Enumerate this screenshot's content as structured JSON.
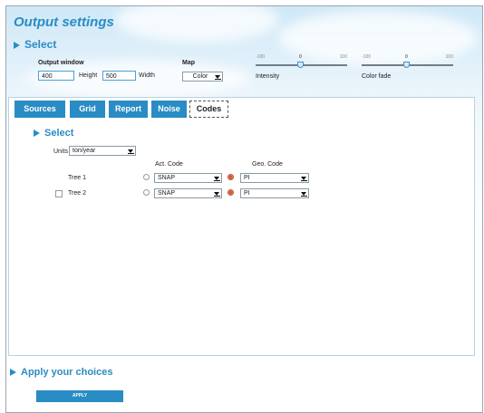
{
  "page": {
    "title": "Output settings"
  },
  "select_section": {
    "label": "Select"
  },
  "output_window": {
    "label": "Output window",
    "height_value": "400",
    "height_label": "Height",
    "width_value": "500",
    "width_label": "Width"
  },
  "map": {
    "label": "Map",
    "selected": "Color"
  },
  "intensity": {
    "label": "Intensity",
    "min": "-100",
    "mid": "0",
    "max": "100",
    "value": 0
  },
  "color_fade": {
    "label": "Color fade",
    "min": "-100",
    "mid": "0",
    "max": "100",
    "value": 0
  },
  "tabs": [
    {
      "label": "Sources"
    },
    {
      "label": "Grid"
    },
    {
      "label": "Report"
    },
    {
      "label": "Noise"
    },
    {
      "label": "Codes",
      "active": true
    }
  ],
  "codes": {
    "section_label": "Select",
    "units_label": "Units",
    "units_value": "ton/year",
    "act_code_header": "Act. Code",
    "geo_code_header": "Geo. Code",
    "rows": [
      {
        "name": "Tree 1",
        "act_code": "SNAP",
        "geo_code": "PI"
      },
      {
        "name": "Tree 2",
        "act_code": "SNAP",
        "geo_code": "PI"
      }
    ]
  },
  "apply": {
    "section_label": "Apply your choices",
    "button_label": "APPLY"
  },
  "colors": {
    "accent": "#2a8cc4",
    "radio_selected": "#d45a3a"
  }
}
